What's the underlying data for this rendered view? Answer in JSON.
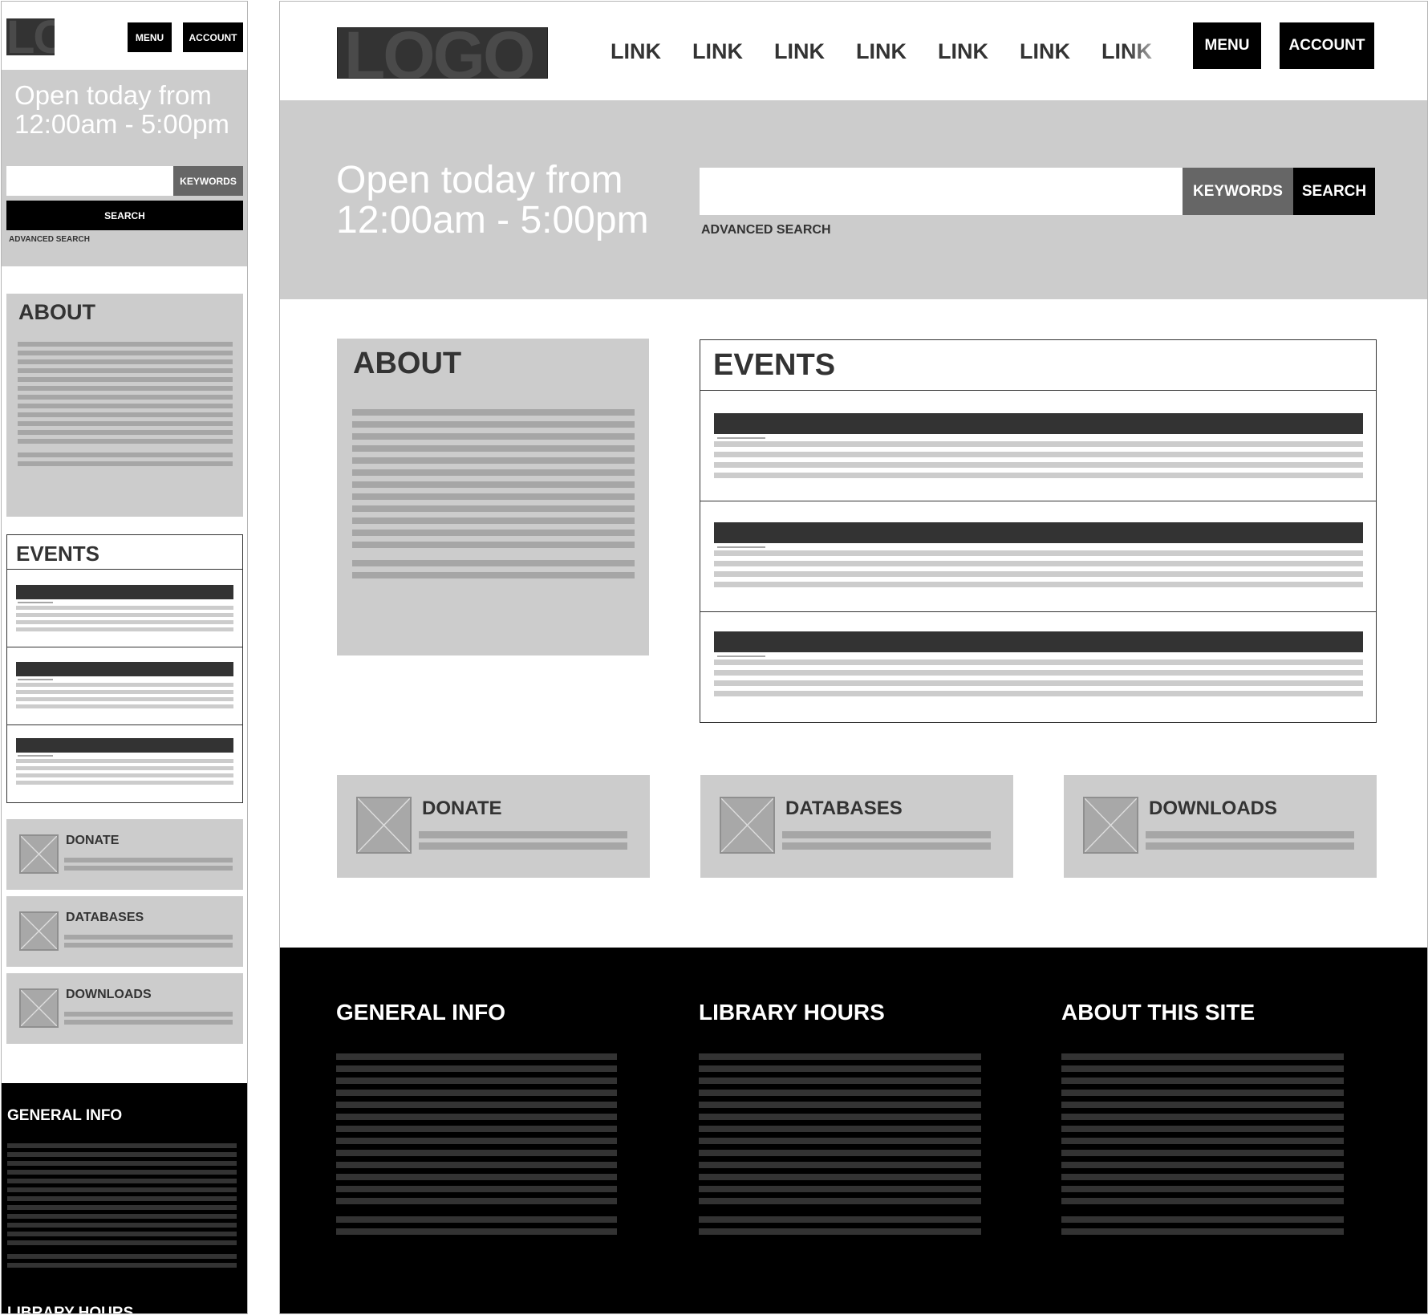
{
  "brand": {
    "logo_text": "LOGO"
  },
  "nav": {
    "links": [
      "LINK",
      "LINK",
      "LINK",
      "LINK",
      "LINK",
      "LINK",
      "LINK"
    ],
    "menu_label": "MENU",
    "account_label": "ACCOUNT"
  },
  "hero": {
    "hours_line1": "Open today from",
    "hours_line2": "12:00am - 5:00pm",
    "search_placeholder": "",
    "keywords_label": "KEYWORDS",
    "search_label": "SEARCH",
    "advanced_label": "ADVANCED SEARCH"
  },
  "about": {
    "title": "ABOUT"
  },
  "events": {
    "title": "EVENTS",
    "items": [
      {},
      {},
      {}
    ]
  },
  "cards": [
    {
      "label": "DONATE",
      "icon": "image-placeholder-icon"
    },
    {
      "label": "DATABASES",
      "icon": "image-placeholder-icon"
    },
    {
      "label": "DOWNLOADS",
      "icon": "image-placeholder-icon"
    }
  ],
  "footer": {
    "columns": [
      {
        "title": "GENERAL INFO"
      },
      {
        "title": "LIBRARY HOURS"
      },
      {
        "title": "ABOUT THIS SITE"
      }
    ]
  },
  "colors": {
    "black": "#000000",
    "panel_gray": "#cccccc",
    "dark_gray": "#333333",
    "line_gray": "#a6a6a6",
    "keywords_gray": "#666666"
  }
}
